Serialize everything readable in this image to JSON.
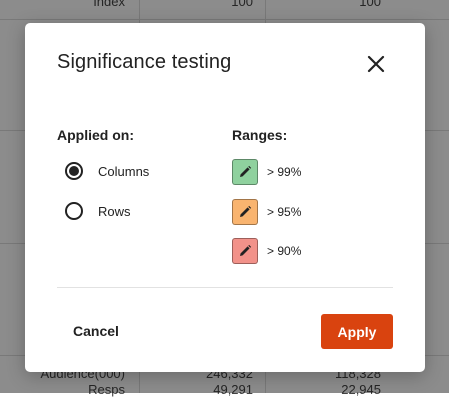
{
  "background_table": {
    "rows": [
      {
        "label": "Index",
        "col1": "100",
        "col2": "100"
      },
      {
        "label": "Audience(000)",
        "col1": "246,332",
        "col2": "118,328"
      },
      {
        "label": "Resps",
        "col1": "49,291",
        "col2": "22,945"
      }
    ]
  },
  "dialog": {
    "title": "Significance testing",
    "close_icon": "close-icon",
    "applied_on": {
      "label": "Applied on:",
      "options": [
        {
          "label": "Columns",
          "selected": true
        },
        {
          "label": "Rows",
          "selected": false
        }
      ]
    },
    "ranges": {
      "label": "Ranges:",
      "items": [
        {
          "label": "> 99%",
          "color": "#8fd19e",
          "icon": "pencil-icon"
        },
        {
          "label": "> 95%",
          "color": "#f9b46f",
          "icon": "pencil-icon"
        },
        {
          "label": "> 90%",
          "color": "#f2928a",
          "icon": "pencil-icon"
        }
      ]
    },
    "cancel_label": "Cancel",
    "apply_label": "Apply",
    "apply_color": "#d9430f"
  }
}
